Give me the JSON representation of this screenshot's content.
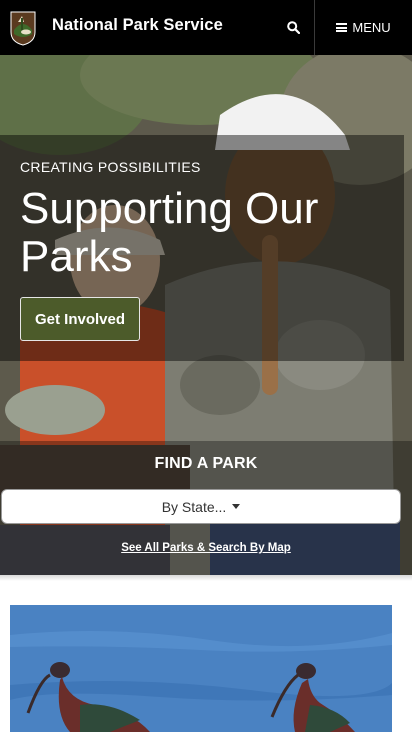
{
  "header": {
    "site_title": "National Park Service",
    "search_icon": "search-icon",
    "menu_label": "MENU",
    "logo": "nps-arrowhead-logo"
  },
  "hero": {
    "eyebrow": "CREATING POSSIBILITIES",
    "title": "Supporting Our Parks",
    "cta_label": "Get Involved",
    "cta_color": "#4c5b2a"
  },
  "find_park": {
    "title": "FIND A PARK",
    "select_value": "By State...",
    "link_label": "See All Parks & Search By Map"
  },
  "colors": {
    "header_bg": "#000000",
    "water": "#4f86c6"
  }
}
